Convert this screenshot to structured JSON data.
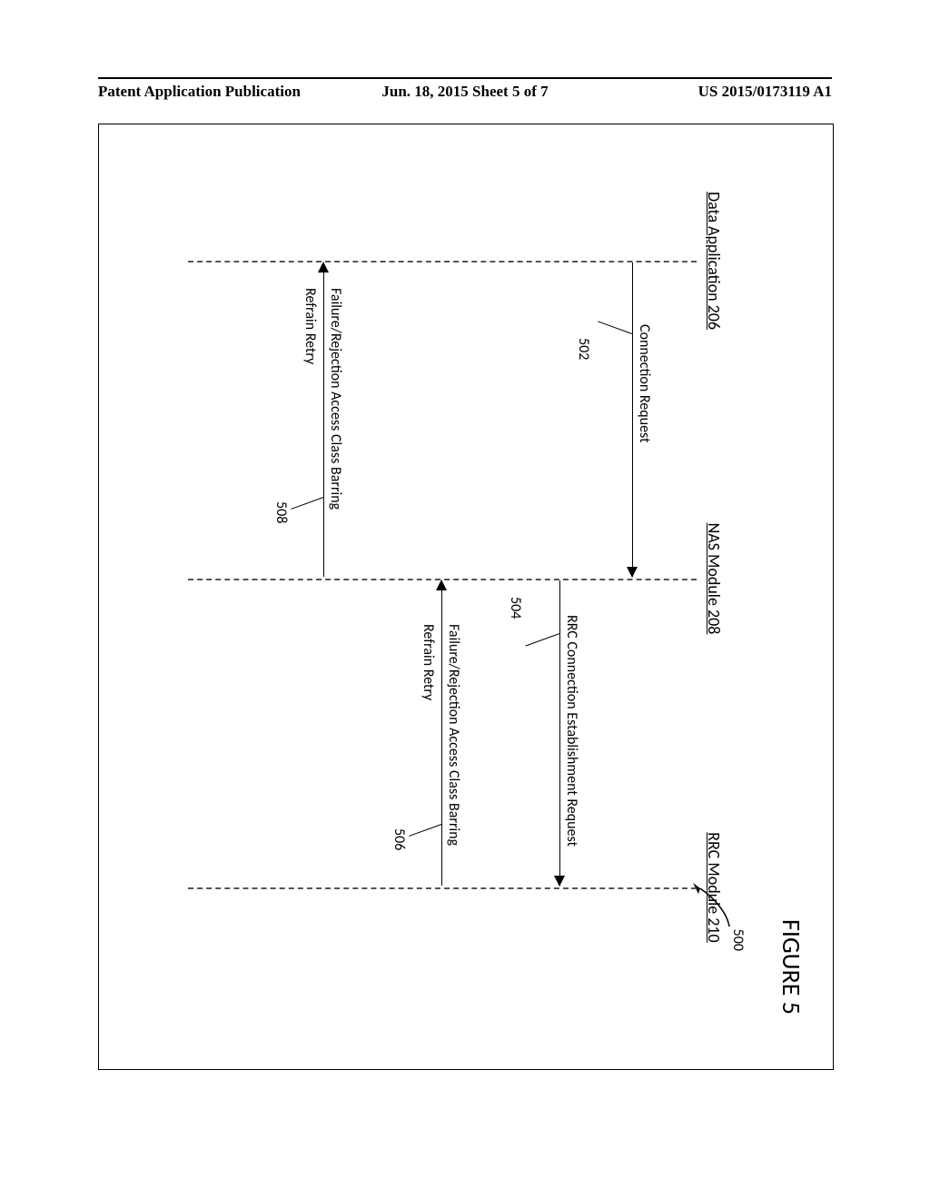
{
  "header": {
    "left": "Patent Application Publication",
    "center": "Jun. 18, 2015  Sheet 5 of 7",
    "right": "US 2015/0173119 A1"
  },
  "figure": {
    "title": "FIGURE 5",
    "ref_num": "500"
  },
  "lanes": {
    "data_app": "Data Application 206",
    "nas": "NAS Module 208",
    "rrc": "RRC Module 210"
  },
  "messages": {
    "m502": {
      "label": "Connection Request",
      "ref": "502"
    },
    "m504": {
      "label": "RRC Connection Establishment Request",
      "ref": "504"
    },
    "m506": {
      "label": "Failure/Rejection Access Class Barring",
      "ref": "506",
      "sub": "Refrain Retry"
    },
    "m508": {
      "label": "Failure/Rejection Access Class Barring",
      "ref": "508",
      "sub": "Refrain Retry"
    }
  },
  "chart_data": {
    "type": "sequence-diagram",
    "title": "FIGURE 5",
    "figure_ref": "500",
    "participants": [
      {
        "id": "data_app",
        "name": "Data Application 206"
      },
      {
        "id": "nas",
        "name": "NAS Module 208"
      },
      {
        "id": "rrc",
        "name": "RRC Module 210"
      }
    ],
    "messages": [
      {
        "ref": "502",
        "from": "data_app",
        "to": "nas",
        "text": "Connection Request"
      },
      {
        "ref": "504",
        "from": "nas",
        "to": "rrc",
        "text": "RRC Connection Establishment Request"
      },
      {
        "ref": "506",
        "from": "rrc",
        "to": "nas",
        "text": "Failure/Rejection Access Class Barring",
        "note": "Refrain Retry"
      },
      {
        "ref": "508",
        "from": "nas",
        "to": "data_app",
        "text": "Failure/Rejection Access Class Barring",
        "note": "Refrain Retry"
      }
    ]
  }
}
